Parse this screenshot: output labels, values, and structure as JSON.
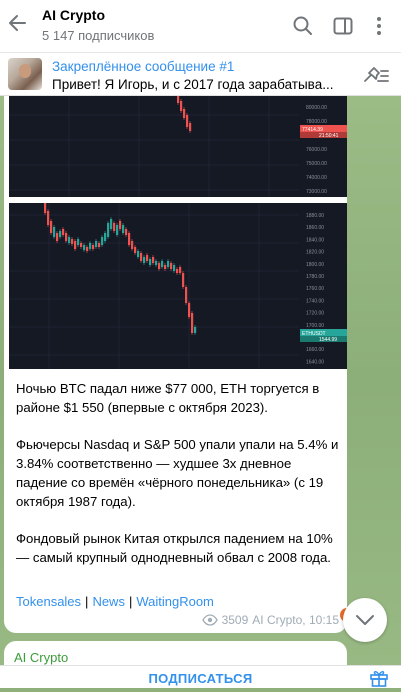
{
  "header": {
    "title": "AI Crypto",
    "subtitle": "5 147 подписчиков"
  },
  "pinned": {
    "title": "Закреплённое сообщение #1",
    "text": "Привет! Я Игорь, и с 2017 года зарабатыва..."
  },
  "charts": {
    "chart1": {
      "price_tag": "77414.39",
      "price_tag2": "21:50:41",
      "axis": [
        "80000.00",
        "78000.00",
        "77000.00",
        "76000.00",
        "75000.00",
        "74000.00",
        "73000.00"
      ]
    },
    "chart2": {
      "price_tag": "ETHUSDT",
      "price_tag2": "1544.99",
      "axis": [
        "1880.00",
        "1860.00",
        "1840.00",
        "1820.00",
        "1800.00",
        "1780.00",
        "1760.00",
        "1740.00",
        "1720.00",
        "1700.00",
        "1680.00",
        "1660.00",
        "1640.00"
      ]
    }
  },
  "message": {
    "p1": "Ночью BTC падал ниже $77 000, ETH торгуется в районе $1 550 (впервые с октября 2023).",
    "p2": "Фьючерсы Nasdaq и S&P 500 упали упали на 5.4% и 3.84% соответственно — худшее 3х дневное падение со времён «чёрного понедельника» (с 19 октября 1987 года).",
    "p3": "Фондовый рынок Китая открылся падением на 10% — самый крупный однодневный обвал с 2008 года.",
    "tags": [
      "Tokensales",
      "News",
      "WaitingRoom"
    ],
    "tag_separator": "|",
    "views": "3509",
    "author_time": "AI Crypto, 10:15"
  },
  "next_message": {
    "sender": "AI Crypto"
  },
  "bottom": {
    "subscribe_label": "ПОДПИСАТЬСЯ"
  },
  "colors": {
    "accent": "#3390ec",
    "chart_bg": "#151924",
    "candle_up": "#26a69a",
    "candle_down": "#ef5350"
  }
}
